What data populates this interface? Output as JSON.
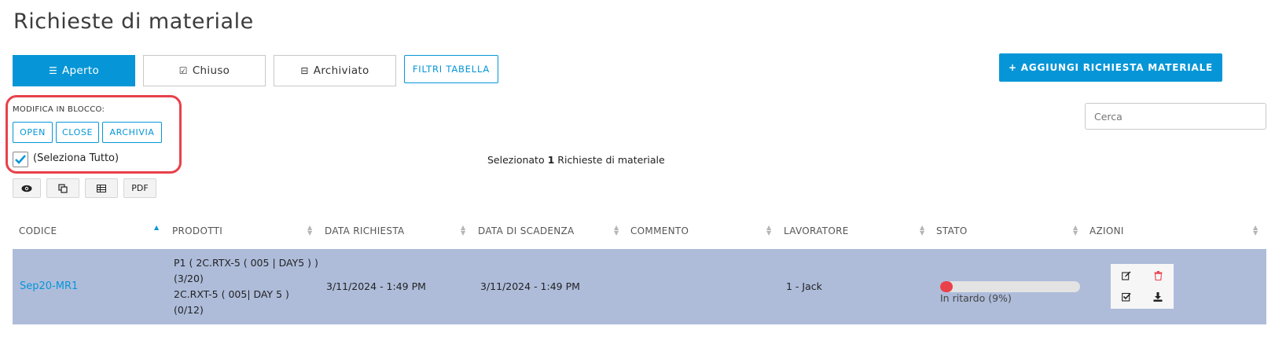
{
  "page": {
    "title": "Richieste di materiale"
  },
  "tabs": [
    {
      "label": "Aperto",
      "icon": "list-icon",
      "active": true
    },
    {
      "label": "Chiuso",
      "icon": "check-square-icon",
      "active": false
    },
    {
      "label": "Archiviato",
      "icon": "inbox-icon",
      "active": false
    }
  ],
  "filters_button": "FILTRI TABELLA",
  "add_button": "+ AGGIUNGI RICHIESTA MATERIALE",
  "bulk": {
    "label": "MODIFICA IN BLOCCO:",
    "buttons": [
      "OPEN",
      "CLOSE",
      "ARCHIVIA"
    ],
    "select_all_label": "(Seleziona Tutto)",
    "select_all_checked": true
  },
  "selection": {
    "prefix": "Selezionato",
    "count": "1",
    "suffix": "Richieste di materiale"
  },
  "search": {
    "placeholder": "Cerca"
  },
  "toolbar": {
    "view_icon": "eye-icon",
    "copy_icon": "copy-icon",
    "table_icon": "table-icon",
    "pdf_label": "PDF"
  },
  "table": {
    "columns": [
      "CODICE",
      "PRODOTTI",
      "DATA RICHIESTA",
      "DATA DI SCADENZA",
      "COMMENTO",
      "LAVORATORE",
      "STATO",
      "AZIONI"
    ],
    "sorted_column": "CODICE",
    "rows": [
      {
        "code": "Sep20-MR1",
        "products": [
          "P1 ( 2C.RTX-5 ( 005 | DAY5 ) )",
          "(3/20)",
          "2C.RXT-5 ( 005| DAY 5 )",
          "(0/12)"
        ],
        "request_date": "3/11/2024 - 1:49 PM",
        "due_date": "3/11/2024 - 1:49 PM",
        "comment": "",
        "worker": "1 - Jack",
        "status_text": "In ritardo (9%)",
        "progress": 0.09,
        "actions": [
          "edit-icon",
          "trash-icon",
          "check-square-icon",
          "download-icon"
        ]
      }
    ]
  },
  "colors": {
    "accent": "#0696d7",
    "danger": "#e8414a",
    "row_selected": "#aebcda"
  }
}
